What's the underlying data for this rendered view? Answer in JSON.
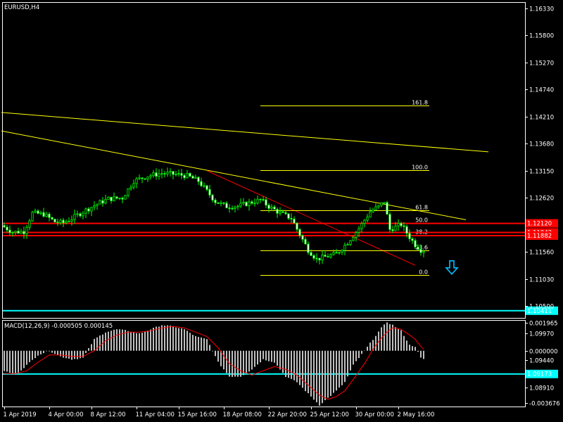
{
  "chart_data": {
    "type": "candlestick",
    "symbol_label": "EURUSD,H4",
    "price_axis": {
      "ylim": [
        1.1027,
        1.1645
      ],
      "ticks": [
        {
          "value": 1.1633,
          "label": "1.16330"
        },
        {
          "value": 1.158,
          "label": "1.15800"
        },
        {
          "value": 1.1527,
          "label": "1.15270"
        },
        {
          "value": 1.1474,
          "label": "1.14740"
        },
        {
          "value": 1.1421,
          "label": "1.14210"
        },
        {
          "value": 1.1368,
          "label": "1.13680"
        },
        {
          "value": 1.1315,
          "label": "1.13150"
        },
        {
          "value": 1.1262,
          "label": "1.12620"
        },
        {
          "value": 1.1156,
          "label": "1.11560"
        },
        {
          "value": 1.1103,
          "label": "1.11030"
        },
        {
          "value": 1.105,
          "label": "1.10500"
        },
        {
          "value": 1.0997,
          "label": "1.09970"
        },
        {
          "value": 1.0944,
          "label": "1.09440"
        },
        {
          "value": 1.0891,
          "label": "1.08910"
        }
      ]
    },
    "time_axis": {
      "bars": 150,
      "labels": [
        {
          "bar": 0,
          "label": "1 Apr 2019"
        },
        {
          "bar": 16,
          "label": "4 Apr 00:00"
        },
        {
          "bar": 31,
          "label": "8 Apr 12:00"
        },
        {
          "bar": 47,
          "label": "11 Apr 04:00"
        },
        {
          "bar": 62,
          "label": "15 Apr 16:00"
        },
        {
          "bar": 78,
          "label": "18 Apr 08:00"
        },
        {
          "bar": 94,
          "label": "22 Apr 20:00"
        },
        {
          "bar": 109,
          "label": "25 Apr 12:00"
        },
        {
          "bar": 125,
          "label": "30 Apr 00:00"
        },
        {
          "bar": 140,
          "label": "2 May 16:00"
        }
      ]
    },
    "price_path": [
      [
        0,
        1.1208
      ],
      [
        4,
        1.1195
      ],
      [
        8,
        1.1196
      ],
      [
        11,
        1.1232
      ],
      [
        15,
        1.123
      ],
      [
        19,
        1.1215
      ],
      [
        22,
        1.1213
      ],
      [
        26,
        1.1225
      ],
      [
        30,
        1.1238
      ],
      [
        34,
        1.125
      ],
      [
        38,
        1.126
      ],
      [
        43,
        1.1262
      ],
      [
        47,
        1.1295
      ],
      [
        52,
        1.1305
      ],
      [
        57,
        1.131
      ],
      [
        62,
        1.1308
      ],
      [
        66,
        1.1305
      ],
      [
        70,
        1.1295
      ],
      [
        73,
        1.1275
      ],
      [
        76,
        1.1255
      ],
      [
        80,
        1.1245
      ],
      [
        84,
        1.1246
      ],
      [
        88,
        1.1252
      ],
      [
        92,
        1.1258
      ],
      [
        95,
        1.1245
      ],
      [
        99,
        1.1232
      ],
      [
        103,
        1.1222
      ],
      [
        106,
        1.119
      ],
      [
        109,
        1.116
      ],
      [
        112,
        1.1142
      ],
      [
        116,
        1.1148
      ],
      [
        119,
        1.1152
      ],
      [
        123,
        1.1175
      ],
      [
        127,
        1.1202
      ],
      [
        131,
        1.1235
      ],
      [
        134,
        1.1245
      ],
      [
        136,
        1.1255
      ],
      [
        138,
        1.12
      ],
      [
        142,
        1.121
      ],
      [
        145,
        1.1185
      ],
      [
        147,
        1.117
      ],
      [
        149,
        1.116
      ]
    ],
    "horizontal_lines": [
      {
        "value": 1.1212,
        "label": "1.12120",
        "color": "#ff0000"
      },
      {
        "value": 1.11942,
        "label": "1.11942",
        "color": "#ff0000"
      },
      {
        "value": 1.1188,
        "label": "1.11882",
        "color": "#ff0000"
      },
      {
        "value": 1.10411,
        "label": "1.10411",
        "color": "#00ffff"
      },
      {
        "value": 1.09173,
        "label": "1.09173",
        "color": "#00ffff"
      }
    ],
    "fibonacci": {
      "start_bar": 91,
      "end_bar": 151,
      "levels": [
        {
          "label": "161.8",
          "value": 1.14427
        },
        {
          "label": "100.0",
          "value": 1.13157
        },
        {
          "label": "61.8",
          "value": 1.12373
        },
        {
          "label": "50.0",
          "value": 1.12131
        },
        {
          "label": "38.2",
          "value": 1.11889
        },
        {
          "label": "23.6",
          "value": 1.11589
        },
        {
          "label": "0.0",
          "value": 1.11105
        }
      ]
    },
    "trendlines": [
      {
        "color": "#ffff00",
        "from": {
          "bar": -1,
          "value": 1.1429
        },
        "to": {
          "bar": 172,
          "value": 1.1352
        }
      },
      {
        "color": "#ffff00",
        "from": {
          "bar": -1,
          "value": 1.1393
        },
        "to": {
          "bar": 164,
          "value": 1.1219
        }
      },
      {
        "color": "#ff0000",
        "from": {
          "bar": 72,
          "value": 1.1315
        },
        "to": {
          "bar": 146,
          "value": 1.113
        }
      }
    ],
    "arrow": {
      "bar": 159,
      "value": 1.1125,
      "direction": "down",
      "color": "#00bfff"
    },
    "macd": {
      "label": "MACD(12,26,9) -0.000505 0.000145",
      "params": [
        12,
        26,
        9
      ],
      "main": -0.000505,
      "signal_value": 0.000145,
      "ylim": [
        -0.0039,
        0.0021
      ],
      "ticks": [
        {
          "value": 0.001965,
          "label": "0.001965"
        },
        {
          "value": 0.0,
          "label": "0.000000"
        },
        {
          "value": -0.003676,
          "label": "-0.003676"
        }
      ],
      "histogram_path": [
        [
          0,
          -0.0014
        ],
        [
          4,
          -0.0017
        ],
        [
          8,
          -0.001
        ],
        [
          12,
          -0.0003
        ],
        [
          16,
          0.0
        ],
        [
          20,
          -0.0004
        ],
        [
          24,
          -0.0006
        ],
        [
          28,
          -0.0005
        ],
        [
          32,
          0.0008
        ],
        [
          36,
          0.0013
        ],
        [
          40,
          0.0015
        ],
        [
          44,
          0.0014
        ],
        [
          48,
          0.0012
        ],
        [
          52,
          0.0015
        ],
        [
          56,
          0.0018
        ],
        [
          60,
          0.0017
        ],
        [
          64,
          0.0015
        ],
        [
          68,
          0.001
        ],
        [
          72,
          0.0008
        ],
        [
          76,
          -0.0008
        ],
        [
          80,
          -0.0018
        ],
        [
          84,
          -0.0018
        ],
        [
          88,
          -0.0013
        ],
        [
          92,
          -0.0006
        ],
        [
          96,
          -0.0008
        ],
        [
          100,
          -0.0018
        ],
        [
          104,
          -0.0022
        ],
        [
          108,
          -0.003
        ],
        [
          112,
          -0.0038
        ],
        [
          115,
          -0.0033
        ],
        [
          118,
          -0.0028
        ],
        [
          121,
          -0.0022
        ],
        [
          124,
          -0.001
        ],
        [
          128,
          0.0
        ],
        [
          131,
          0.0008
        ],
        [
          134,
          0.0016
        ],
        [
          136,
          0.002
        ],
        [
          138,
          0.0018
        ],
        [
          141,
          0.0014
        ],
        [
          144,
          0.0004
        ],
        [
          146,
          0.0003
        ],
        [
          148,
          -0.0005
        ],
        [
          149,
          -0.0006
        ]
      ],
      "signal_path": [
        [
          0,
          -0.0016
        ],
        [
          4,
          -0.0016
        ],
        [
          8,
          -0.0014
        ],
        [
          12,
          -0.0008
        ],
        [
          16,
          -0.0003
        ],
        [
          20,
          -0.0003
        ],
        [
          24,
          -0.0004
        ],
        [
          28,
          -0.0004
        ],
        [
          32,
          0.0
        ],
        [
          36,
          0.0007
        ],
        [
          40,
          0.0011
        ],
        [
          44,
          0.0013
        ],
        [
          48,
          0.0013
        ],
        [
          52,
          0.0014
        ],
        [
          56,
          0.0016
        ],
        [
          60,
          0.0017
        ],
        [
          64,
          0.0016
        ],
        [
          68,
          0.0013
        ],
        [
          72,
          0.001
        ],
        [
          76,
          0.0002
        ],
        [
          80,
          -0.0009
        ],
        [
          84,
          -0.0014
        ],
        [
          88,
          -0.0017
        ],
        [
          92,
          -0.0014
        ],
        [
          96,
          -0.0011
        ],
        [
          100,
          -0.0013
        ],
        [
          104,
          -0.0017
        ],
        [
          108,
          -0.0024
        ],
        [
          112,
          -0.0031
        ],
        [
          115,
          -0.0034
        ],
        [
          118,
          -0.0032
        ],
        [
          121,
          -0.0028
        ],
        [
          124,
          -0.002
        ],
        [
          128,
          -0.0009
        ],
        [
          131,
          0.0001
        ],
        [
          134,
          0.0009
        ],
        [
          136,
          0.0013
        ],
        [
          138,
          0.0016
        ],
        [
          141,
          0.0015
        ],
        [
          144,
          0.0011
        ],
        [
          146,
          0.0008
        ],
        [
          148,
          0.0003
        ],
        [
          149,
          0.0001
        ]
      ]
    }
  }
}
